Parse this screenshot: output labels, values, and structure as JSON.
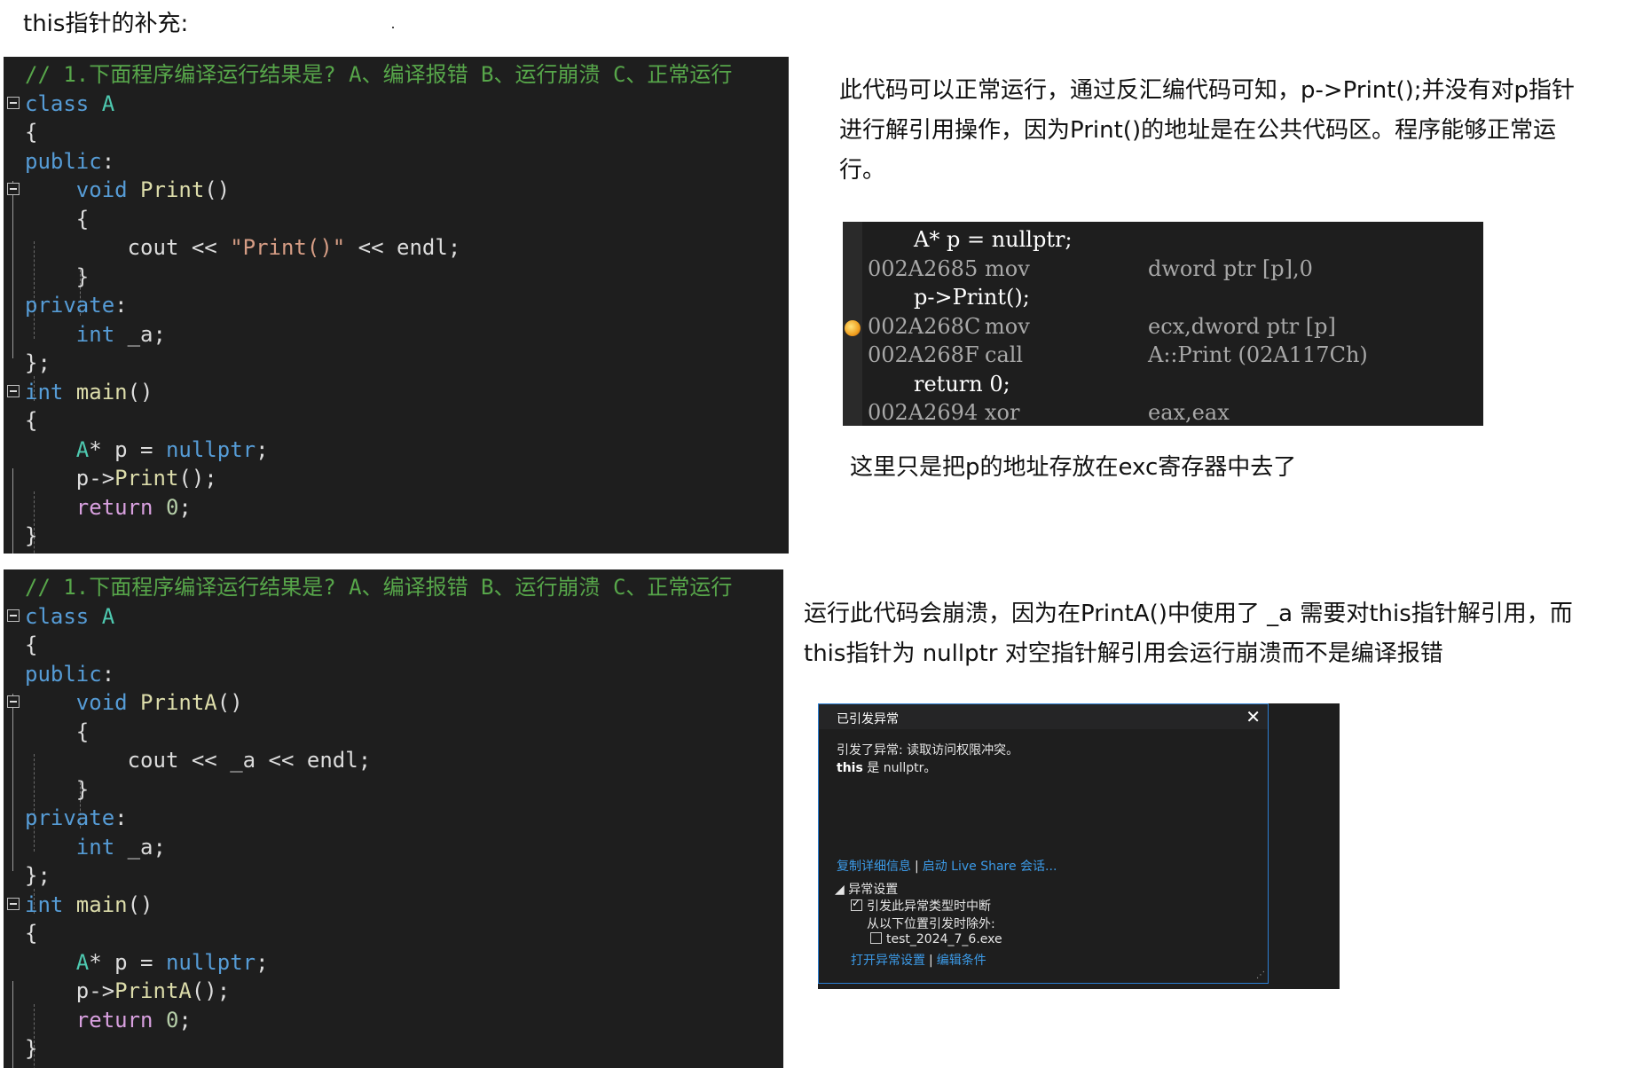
{
  "page_title": "this指针的补充:",
  "code_block_1": {
    "lines": [
      {
        "fold": false,
        "parts": [
          {
            "t": "// 1.下面程序编译运行结果是? A、编译报错 B、运行崩溃 C、正常运行",
            "c": "cm"
          }
        ]
      },
      {
        "fold": true,
        "parts": [
          {
            "t": "class ",
            "c": "kw"
          },
          {
            "t": "A",
            "c": "ty"
          }
        ]
      },
      {
        "fold": false,
        "parts": [
          {
            "t": "{",
            "c": ""
          }
        ]
      },
      {
        "fold": false,
        "parts": [
          {
            "t": "public",
            "c": "kw"
          },
          {
            "t": ":",
            "c": ""
          }
        ]
      },
      {
        "fold": true,
        "parts": [
          {
            "t": "    "
          },
          {
            "t": "void ",
            "c": "kw"
          },
          {
            "t": "Print",
            "c": "fn"
          },
          {
            "t": "()",
            "c": ""
          }
        ]
      },
      {
        "fold": false,
        "parts": [
          {
            "t": "    {",
            "c": ""
          }
        ]
      },
      {
        "fold": false,
        "parts": [
          {
            "t": "        cout << ",
            "c": ""
          },
          {
            "t": "\"Print()\"",
            "c": "str"
          },
          {
            "t": " << endl;",
            "c": ""
          }
        ]
      },
      {
        "fold": false,
        "parts": [
          {
            "t": "    }",
            "c": ""
          }
        ]
      },
      {
        "fold": false,
        "parts": [
          {
            "t": "private",
            "c": "kw"
          },
          {
            "t": ":",
            "c": ""
          }
        ]
      },
      {
        "fold": false,
        "parts": [
          {
            "t": "    "
          },
          {
            "t": "int ",
            "c": "kw"
          },
          {
            "t": "_a",
            "c": "mem"
          },
          {
            "t": ";",
            "c": ""
          }
        ]
      },
      {
        "fold": false,
        "parts": [
          {
            "t": "};",
            "c": ""
          }
        ]
      },
      {
        "fold": true,
        "parts": [
          {
            "t": "int ",
            "c": "kw"
          },
          {
            "t": "main",
            "c": "fn"
          },
          {
            "t": "()",
            "c": ""
          }
        ]
      },
      {
        "fold": false,
        "parts": [
          {
            "t": "{",
            "c": ""
          }
        ]
      },
      {
        "fold": false,
        "parts": [
          {
            "t": "    "
          },
          {
            "t": "A",
            "c": "ty"
          },
          {
            "t": "* p = ",
            "c": ""
          },
          {
            "t": "nullptr",
            "c": "kw"
          },
          {
            "t": ";",
            "c": ""
          }
        ]
      },
      {
        "fold": false,
        "parts": [
          {
            "t": "    p->",
            "c": ""
          },
          {
            "t": "Print",
            "c": "fn"
          },
          {
            "t": "();",
            "c": ""
          }
        ]
      },
      {
        "fold": false,
        "parts": [
          {
            "t": "    "
          },
          {
            "t": "return ",
            "c": "ctl"
          },
          {
            "t": "0",
            "c": "num"
          },
          {
            "t": ";",
            "c": ""
          }
        ]
      },
      {
        "fold": false,
        "parts": [
          {
            "t": "}",
            "c": ""
          }
        ]
      }
    ]
  },
  "code_block_2": {
    "lines": [
      {
        "fold": false,
        "parts": [
          {
            "t": "// 1.下面程序编译运行结果是? A、编译报错 B、运行崩溃 C、正常运行",
            "c": "cm"
          }
        ]
      },
      {
        "fold": true,
        "parts": [
          {
            "t": "class ",
            "c": "kw"
          },
          {
            "t": "A",
            "c": "ty"
          }
        ]
      },
      {
        "fold": false,
        "parts": [
          {
            "t": "{",
            "c": ""
          }
        ]
      },
      {
        "fold": false,
        "parts": [
          {
            "t": "public",
            "c": "kw"
          },
          {
            "t": ":",
            "c": ""
          }
        ]
      },
      {
        "fold": true,
        "parts": [
          {
            "t": "    "
          },
          {
            "t": "void ",
            "c": "kw"
          },
          {
            "t": "PrintA",
            "c": "fn"
          },
          {
            "t": "()",
            "c": ""
          }
        ]
      },
      {
        "fold": false,
        "parts": [
          {
            "t": "    {",
            "c": ""
          }
        ]
      },
      {
        "fold": false,
        "parts": [
          {
            "t": "        cout << ",
            "c": ""
          },
          {
            "t": "_a",
            "c": "mem"
          },
          {
            "t": " << endl;",
            "c": ""
          }
        ]
      },
      {
        "fold": false,
        "parts": [
          {
            "t": "    }",
            "c": ""
          }
        ]
      },
      {
        "fold": false,
        "parts": [
          {
            "t": "private",
            "c": "kw"
          },
          {
            "t": ":",
            "c": ""
          }
        ]
      },
      {
        "fold": false,
        "parts": [
          {
            "t": "    "
          },
          {
            "t": "int ",
            "c": "kw"
          },
          {
            "t": "_a",
            "c": "mem"
          },
          {
            "t": ";",
            "c": ""
          }
        ]
      },
      {
        "fold": false,
        "parts": [
          {
            "t": "};",
            "c": ""
          }
        ]
      },
      {
        "fold": true,
        "parts": [
          {
            "t": "int ",
            "c": "kw"
          },
          {
            "t": "main",
            "c": "fn"
          },
          {
            "t": "()",
            "c": ""
          }
        ]
      },
      {
        "fold": false,
        "parts": [
          {
            "t": "{",
            "c": ""
          }
        ]
      },
      {
        "fold": false,
        "parts": [
          {
            "t": "    "
          },
          {
            "t": "A",
            "c": "ty"
          },
          {
            "t": "* p = ",
            "c": ""
          },
          {
            "t": "nullptr",
            "c": "kw"
          },
          {
            "t": ";",
            "c": ""
          }
        ]
      },
      {
        "fold": false,
        "parts": [
          {
            "t": "    p->",
            "c": ""
          },
          {
            "t": "PrintA",
            "c": "fn"
          },
          {
            "t": "();",
            "c": ""
          }
        ]
      },
      {
        "fold": false,
        "parts": [
          {
            "t": "    "
          },
          {
            "t": "return ",
            "c": "ctl"
          },
          {
            "t": "0",
            "c": "num"
          },
          {
            "t": ";",
            "c": ""
          }
        ]
      },
      {
        "fold": false,
        "parts": [
          {
            "t": "}",
            "c": ""
          }
        ]
      }
    ]
  },
  "explanation_1": "此代码可以正常运行，通过反汇编代码可知，p->Print();并没有对p指针进行解引用操作，因为Print()的地址是在公共代码区。程序能够正常运行。",
  "disassembly": [
    {
      "kind": "src",
      "text": "A* p = nullptr;"
    },
    {
      "kind": "asm",
      "addr": "002A2685",
      "op": "mov",
      "arg": "dword ptr [p],0"
    },
    {
      "kind": "src",
      "text": "p->Print();"
    },
    {
      "kind": "asm",
      "addr": "002A268C",
      "op": "mov",
      "arg": "ecx,dword ptr [p]",
      "breakpoint": true
    },
    {
      "kind": "asm",
      "addr": "002A268F",
      "op": "call",
      "arg": "A::Print (02A117Ch)"
    },
    {
      "kind": "src",
      "text": "return 0;"
    },
    {
      "kind": "asm",
      "addr": "002A2694",
      "op": "xor",
      "arg": "eax,eax"
    }
  ],
  "note_1": "这里只是把p的地址存放在exc寄存器中去了",
  "explanation_2": "运行此代码会崩溃，因为在PrintA()中使用了 _a 需要对this指针解引用，而this指针为 nullptr 对空指针解引用会运行崩溃而不是编译报错",
  "exception_dialog": {
    "title": "已引发异常",
    "close": "✕",
    "message_line1": "引发了异常: 读取访问权限冲突。",
    "message_this": "this",
    "message_line2": " 是 nullptr。",
    "link_copy": "复制详细信息",
    "link_separator": "|",
    "link_liveshare": "启动 Live Share 会话...",
    "settings_header": "◢ 异常设置",
    "break_when_thrown": "引发此异常类型时中断",
    "except_when_from": "从以下位置引发时除外:",
    "module_name": "test_2024_7_6.exe",
    "link_open_settings": "打开异常设置",
    "link_edit_conditions": "编辑条件"
  }
}
